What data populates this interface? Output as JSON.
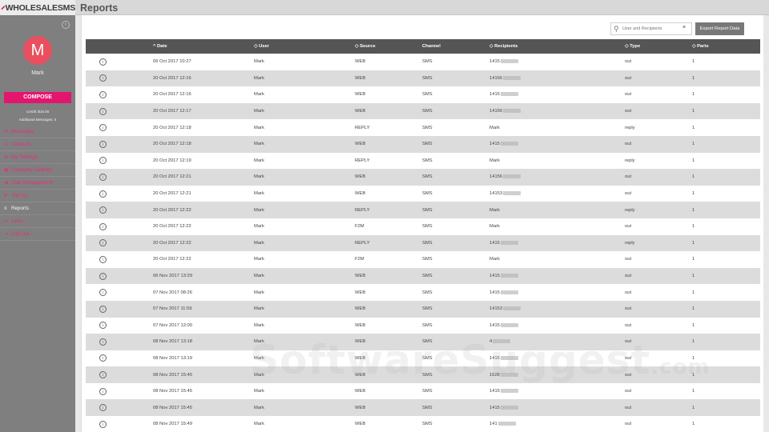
{
  "app": {
    "logo_text": "WHOLESALESMS",
    "page_title": "Reports"
  },
  "sidebar": {
    "avatar_letter": "M",
    "user_name": "Mark",
    "compose_label": "COMPOSE",
    "credit_text": "Credit: $16.00",
    "additional_text": "Additional Messages: 0",
    "items": [
      {
        "label": "Messages",
        "icon": "chat-icon",
        "active": false
      },
      {
        "label": "Contacts",
        "icon": "person-icon",
        "active": false
      },
      {
        "label": "My Settings",
        "icon": "gear-icon",
        "active": false
      },
      {
        "label": "Company Settings",
        "icon": "briefcase-icon",
        "active": false
      },
      {
        "label": "User Management",
        "icon": "users-icon",
        "active": false
      },
      {
        "label": "Top Up",
        "icon": "heart-icon",
        "active": false
      },
      {
        "label": "Reports",
        "icon": "list-icon",
        "active": true
      },
      {
        "label": "Links",
        "icon": "link-icon",
        "active": false
      },
      {
        "label": "Log Out",
        "icon": "logout-icon",
        "active": false
      }
    ]
  },
  "toolbar": {
    "search_placeholder": "User and Recipients",
    "clear_label": "×",
    "export_label": "Export Report Data"
  },
  "table": {
    "columns": [
      "^ Date",
      "◇ User",
      "◇ Source",
      "Channel",
      "◇ Recipients",
      "◇ Type",
      "◇ Parts"
    ],
    "rows": [
      {
        "date": "06 Oct 2017 10:27",
        "user": "Mark",
        "source": "WEB",
        "channel": "SMS",
        "recipient": "1415",
        "type": "out",
        "parts": "1"
      },
      {
        "date": "20 Oct 2017 12:16",
        "user": "Mark",
        "source": "WEB",
        "channel": "SMS",
        "recipient": "14156",
        "type": "out",
        "parts": "1"
      },
      {
        "date": "20 Oct 2017 12:16",
        "user": "Mark",
        "source": "WEB",
        "channel": "SMS",
        "recipient": "1415",
        "type": "out",
        "parts": "1"
      },
      {
        "date": "20 Oct 2017 12:17",
        "user": "Mark",
        "source": "WEB",
        "channel": "SMS",
        "recipient": "14156",
        "type": "out",
        "parts": "1"
      },
      {
        "date": "20 Oct 2017 12:18",
        "user": "Mark",
        "source": "REPLY",
        "channel": "SMS",
        "recipient": "Mark",
        "type": "reply",
        "parts": "1"
      },
      {
        "date": "20 Oct 2017 12:18",
        "user": "Mark",
        "source": "WEB",
        "channel": "SMS",
        "recipient": "1415",
        "type": "out",
        "parts": "1"
      },
      {
        "date": "20 Oct 2017 12:19",
        "user": "Mark",
        "source": "REPLY",
        "channel": "SMS",
        "recipient": "Mark",
        "type": "reply",
        "parts": "1"
      },
      {
        "date": "20 Oct 2017 12:21",
        "user": "Mark",
        "source": "WEB",
        "channel": "SMS",
        "recipient": "14156",
        "type": "out",
        "parts": "1"
      },
      {
        "date": "20 Oct 2017 12:21",
        "user": "Mark",
        "source": "WEB",
        "channel": "SMS",
        "recipient": "14153",
        "type": "out",
        "parts": "1"
      },
      {
        "date": "20 Oct 2017 12:22",
        "user": "Mark",
        "source": "REPLY",
        "channel": "SMS",
        "recipient": "Mark",
        "type": "reply",
        "parts": "1"
      },
      {
        "date": "20 Oct 2017 12:22",
        "user": "Mark",
        "source": "F2M",
        "channel": "SMS",
        "recipient": "Mark",
        "type": "out",
        "parts": "1"
      },
      {
        "date": "20 Oct 2017 12:22",
        "user": "Mark",
        "source": "REPLY",
        "channel": "SMS",
        "recipient": "1415",
        "type": "reply",
        "parts": "1"
      },
      {
        "date": "20 Oct 2017 12:22",
        "user": "Mark",
        "source": "F2M",
        "channel": "SMS",
        "recipient": "Mark",
        "type": "out",
        "parts": "1"
      },
      {
        "date": "06 Nov 2017 13:29",
        "user": "Mark",
        "source": "WEB",
        "channel": "SMS",
        "recipient": "1415",
        "type": "out",
        "parts": "1"
      },
      {
        "date": "07 Nov 2017 08:26",
        "user": "Mark",
        "source": "WEB",
        "channel": "SMS",
        "recipient": "1415",
        "type": "out",
        "parts": "1"
      },
      {
        "date": "07 Nov 2017 11:59",
        "user": "Mark",
        "source": "WEB",
        "channel": "SMS",
        "recipient": "14153",
        "type": "out",
        "parts": "1"
      },
      {
        "date": "07 Nov 2017 12:00",
        "user": "Mark",
        "source": "WEB",
        "channel": "SMS",
        "recipient": "1415",
        "type": "out",
        "parts": "1"
      },
      {
        "date": "08 Nov 2017 13:18",
        "user": "Mark",
        "source": "WEB",
        "channel": "SMS",
        "recipient": "4",
        "type": "out",
        "parts": "1"
      },
      {
        "date": "08 Nov 2017 13:19",
        "user": "Mark",
        "source": "WEB",
        "channel": "SMS",
        "recipient": "1415",
        "type": "out",
        "parts": "1"
      },
      {
        "date": "08 Nov 2017 15:45",
        "user": "Mark",
        "source": "WEB",
        "channel": "SMS",
        "recipient": "1628",
        "type": "out",
        "parts": "1"
      },
      {
        "date": "08 Nov 2017 15:45",
        "user": "Mark",
        "source": "WEB",
        "channel": "SMS",
        "recipient": "1415",
        "type": "out",
        "parts": "1"
      },
      {
        "date": "08 Nov 2017 15:45",
        "user": "Mark",
        "source": "WEB",
        "channel": "SMS",
        "recipient": "1415",
        "type": "out",
        "parts": "1"
      },
      {
        "date": "08 Nov 2017 15:49",
        "user": "Mark",
        "source": "WEB",
        "channel": "SMS",
        "recipient": "141",
        "type": "out",
        "parts": "1"
      }
    ]
  },
  "watermark": {
    "main": "SoftwareSuggest",
    "suffix": ".com"
  },
  "colors": {
    "accent": "#e4156e",
    "sidebar": "#7f7f7f",
    "header": "#555555",
    "avatar": "#e9505f"
  }
}
